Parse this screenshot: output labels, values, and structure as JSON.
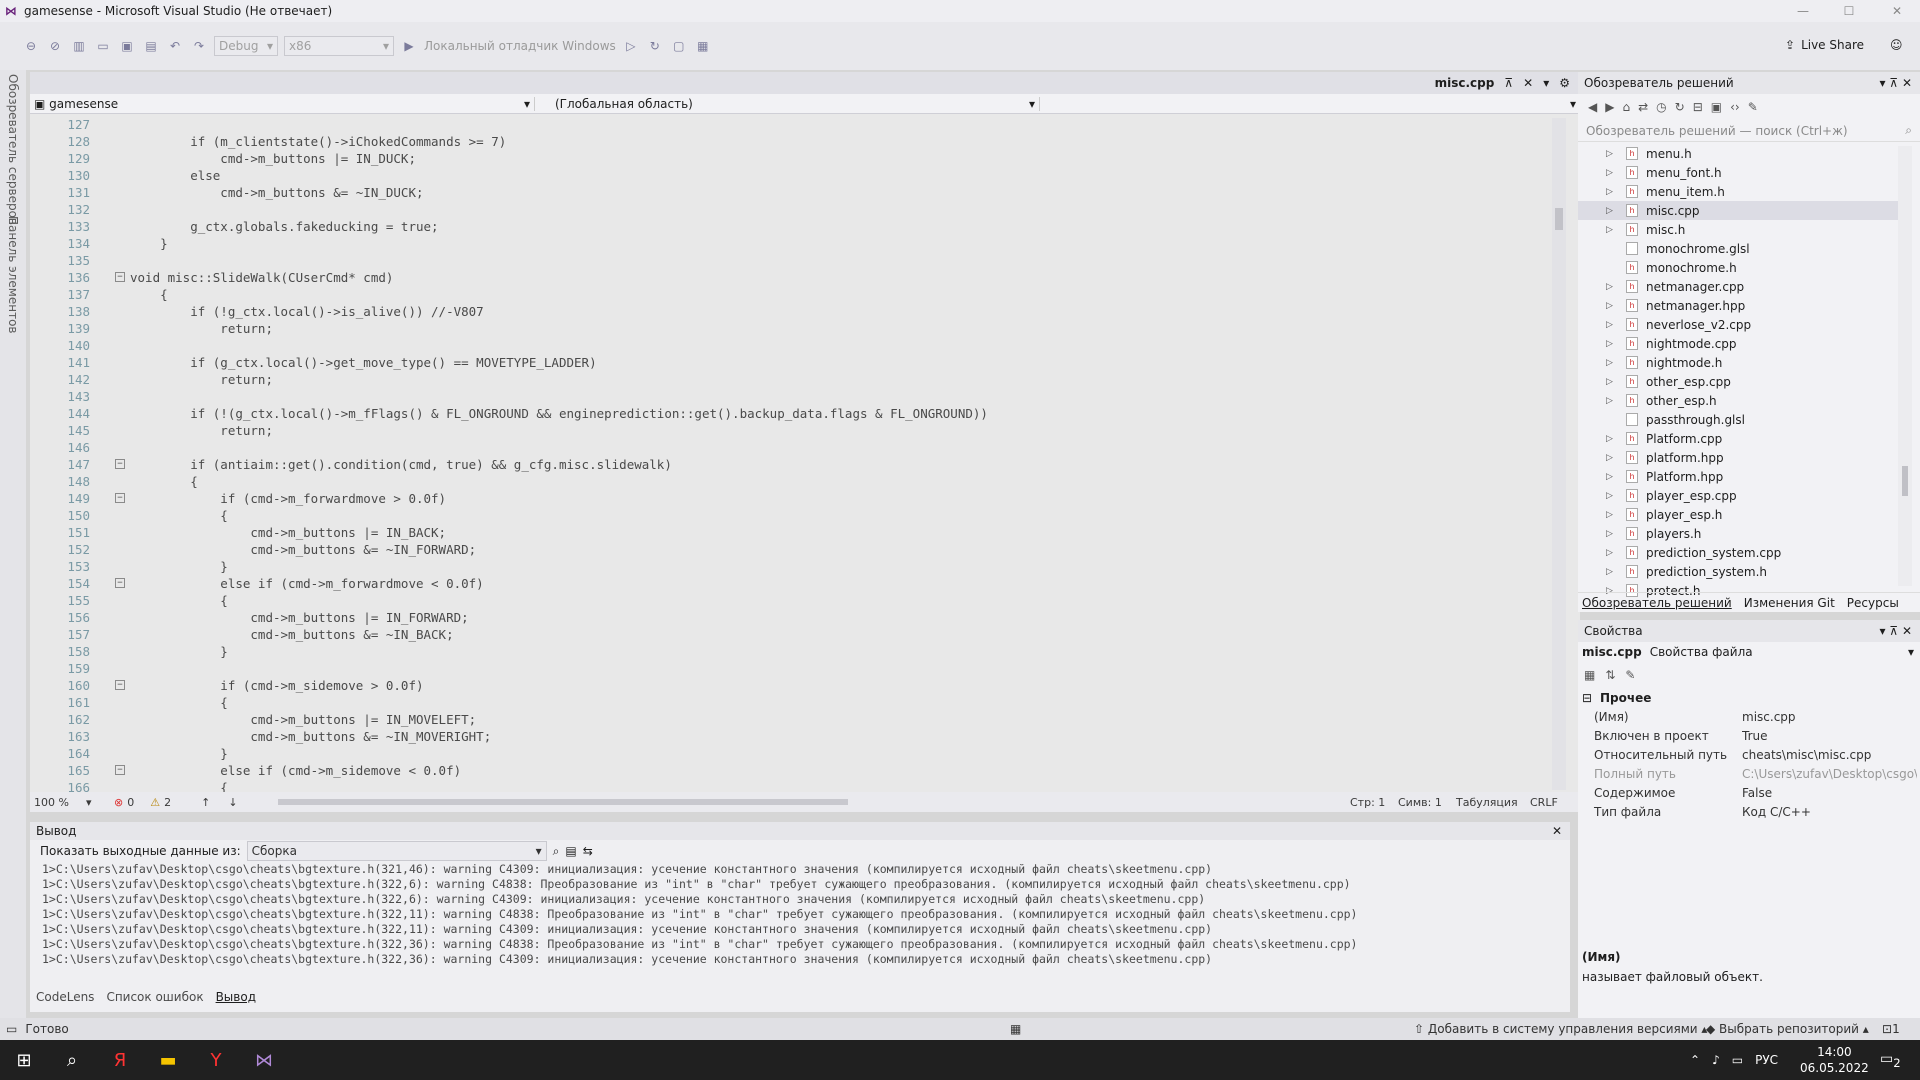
{
  "window": {
    "title": "gamesense - Microsoft Visual Studio (Не отвечает)"
  },
  "toolbar": {
    "config": "Debug",
    "platform": "x86",
    "debugger": "Локальный отладчик Windows",
    "live_share": "Live Share"
  },
  "left_strip": {
    "server_explorer": "Обозреватель серверов",
    "toolbox": "Панель элементов"
  },
  "editor": {
    "tab_name": "misc.cpp",
    "project": "gamesense",
    "scope": "(Глобальная область)",
    "zoom": "100 %",
    "errors": "0",
    "warnings": "2",
    "line": "Стр: 1",
    "char": "Симв: 1",
    "indent": "Табуляция",
    "eol": "CRLF",
    "lines": [
      {
        "n": "127",
        "t": ""
      },
      {
        "n": "128",
        "t": "        if (m_clientstate()->iChokedCommands >= 7)"
      },
      {
        "n": "129",
        "t": "            cmd->m_buttons |= IN_DUCK;"
      },
      {
        "n": "130",
        "t": "        else"
      },
      {
        "n": "131",
        "t": "            cmd->m_buttons &= ~IN_DUCK;"
      },
      {
        "n": "132",
        "t": ""
      },
      {
        "n": "133",
        "t": "        g_ctx.globals.fakeducking = true;"
      },
      {
        "n": "134",
        "t": "    }"
      },
      {
        "n": "135",
        "t": ""
      },
      {
        "n": "136",
        "t": "void misc::SlideWalk(CUserCmd* cmd)"
      },
      {
        "n": "137",
        "t": "    {"
      },
      {
        "n": "138",
        "t": "        if (!g_ctx.local()->is_alive()) //-V807"
      },
      {
        "n": "139",
        "t": "            return;"
      },
      {
        "n": "140",
        "t": ""
      },
      {
        "n": "141",
        "t": "        if (g_ctx.local()->get_move_type() == MOVETYPE_LADDER)"
      },
      {
        "n": "142",
        "t": "            return;"
      },
      {
        "n": "143",
        "t": ""
      },
      {
        "n": "144",
        "t": "        if (!(g_ctx.local()->m_fFlags() & FL_ONGROUND && engineprediction::get().backup_data.flags & FL_ONGROUND))"
      },
      {
        "n": "145",
        "t": "            return;"
      },
      {
        "n": "146",
        "t": ""
      },
      {
        "n": "147",
        "t": "        if (antiaim::get().condition(cmd, true) && g_cfg.misc.slidewalk)"
      },
      {
        "n": "148",
        "t": "        {"
      },
      {
        "n": "149",
        "t": "            if (cmd->m_forwardmove > 0.0f)"
      },
      {
        "n": "150",
        "t": "            {"
      },
      {
        "n": "151",
        "t": "                cmd->m_buttons |= IN_BACK;"
      },
      {
        "n": "152",
        "t": "                cmd->m_buttons &= ~IN_FORWARD;"
      },
      {
        "n": "153",
        "t": "            }"
      },
      {
        "n": "154",
        "t": "            else if (cmd->m_forwardmove < 0.0f)"
      },
      {
        "n": "155",
        "t": "            {"
      },
      {
        "n": "156",
        "t": "                cmd->m_buttons |= IN_FORWARD;"
      },
      {
        "n": "157",
        "t": "                cmd->m_buttons &= ~IN_BACK;"
      },
      {
        "n": "158",
        "t": "            }"
      },
      {
        "n": "159",
        "t": ""
      },
      {
        "n": "160",
        "t": "            if (cmd->m_sidemove > 0.0f)"
      },
      {
        "n": "161",
        "t": "            {"
      },
      {
        "n": "162",
        "t": "                cmd->m_buttons |= IN_MOVELEFT;"
      },
      {
        "n": "163",
        "t": "                cmd->m_buttons &= ~IN_MOVERIGHT;"
      },
      {
        "n": "164",
        "t": "            }"
      },
      {
        "n": "165",
        "t": "            else if (cmd->m_sidemove < 0.0f)"
      },
      {
        "n": "166",
        "t": "            {"
      }
    ]
  },
  "output": {
    "title": "Вывод",
    "show_from_label": "Показать выходные данные из:",
    "source": "Сборка",
    "lines": [
      "1>C:\\Users\\zufav\\Desktop\\csgo\\cheats\\bgtexture.h(321,46): warning C4309: инициализация: усечение константного значения (компилируется исходный файл cheats\\skeetmenu.cpp)",
      "1>C:\\Users\\zufav\\Desktop\\csgo\\cheats\\bgtexture.h(322,6): warning C4838: Преобразование из \"int\" в \"char\" требует сужающего преобразования. (компилируется исходный файл cheats\\skeetmenu.cpp)",
      "1>C:\\Users\\zufav\\Desktop\\csgo\\cheats\\bgtexture.h(322,6): warning C4309: инициализация: усечение константного значения (компилируется исходный файл cheats\\skeetmenu.cpp)",
      "1>C:\\Users\\zufav\\Desktop\\csgo\\cheats\\bgtexture.h(322,11): warning C4838: Преобразование из \"int\" в \"char\" требует сужающего преобразования. (компилируется исходный файл cheats\\skeetmenu.cpp)",
      "1>C:\\Users\\zufav\\Desktop\\csgo\\cheats\\bgtexture.h(322,11): warning C4309: инициализация: усечение константного значения (компилируется исходный файл cheats\\skeetmenu.cpp)",
      "1>C:\\Users\\zufav\\Desktop\\csgo\\cheats\\bgtexture.h(322,36): warning C4838: Преобразование из \"int\" в \"char\" требует сужающего преобразования. (компилируется исходный файл cheats\\skeetmenu.cpp)",
      "1>C:\\Users\\zufav\\Desktop\\csgo\\cheats\\bgtexture.h(322,36): warning C4309: инициализация: усечение константного значения (компилируется исходный файл cheats\\skeetmenu.cpp)"
    ],
    "tabs": [
      "CodeLens",
      "Список ошибок",
      "Вывод"
    ]
  },
  "solution_explorer": {
    "title": "Обозреватель решений",
    "search_placeholder": "Обозреватель решений — поиск (Ctrl+ж)",
    "files": [
      {
        "name": "menu.h",
        "exp": true
      },
      {
        "name": "menu_font.h",
        "exp": true
      },
      {
        "name": "menu_item.h",
        "exp": true
      },
      {
        "name": "misc.cpp",
        "exp": true,
        "sel": true
      },
      {
        "name": "misc.h",
        "exp": true
      },
      {
        "name": "monochrome.glsl",
        "exp": false
      },
      {
        "name": "monochrome.h",
        "exp": false
      },
      {
        "name": "netmanager.cpp",
        "exp": true
      },
      {
        "name": "netmanager.hpp",
        "exp": true
      },
      {
        "name": "neverlose_v2.cpp",
        "exp": true
      },
      {
        "name": "nightmode.cpp",
        "exp": true
      },
      {
        "name": "nightmode.h",
        "exp": true
      },
      {
        "name": "other_esp.cpp",
        "exp": true
      },
      {
        "name": "other_esp.h",
        "exp": true
      },
      {
        "name": "passthrough.glsl",
        "exp": false
      },
      {
        "name": "Platform.cpp",
        "exp": true
      },
      {
        "name": "platform.hpp",
        "exp": true
      },
      {
        "name": "Platform.hpp",
        "exp": true
      },
      {
        "name": "player_esp.cpp",
        "exp": true
      },
      {
        "name": "player_esp.h",
        "exp": true
      },
      {
        "name": "players.h",
        "exp": true
      },
      {
        "name": "prediction_system.cpp",
        "exp": true
      },
      {
        "name": "prediction_system.h",
        "exp": true
      },
      {
        "name": "protect.h",
        "exp": true
      }
    ],
    "tabs": [
      "Обозреватель решений",
      "Изменения Git",
      "Ресурсы"
    ]
  },
  "properties": {
    "title": "Свойства",
    "object": "misc.cpp",
    "object_type": "Свойства файла",
    "category": "Прочее",
    "rows": [
      {
        "k": "(Имя)",
        "v": "misc.cpp"
      },
      {
        "k": "Включен в проект",
        "v": "True"
      },
      {
        "k": "Относительный путь",
        "v": "cheats\\misc\\misc.cpp"
      },
      {
        "k": "Полный путь",
        "v": "C:\\Users\\zufav\\Desktop\\csgo\\cl"
      },
      {
        "k": "Содержимое",
        "v": "False"
      },
      {
        "k": "Тип файла",
        "v": "Код C/C++"
      }
    ],
    "desc_title": "(Имя)",
    "desc_text": "называет файловый объект."
  },
  "status": {
    "ready": "Готово",
    "add_vcs": "Добавить в систему управления версиями",
    "select_repo": "Выбрать репозиторий",
    "notif": "1"
  },
  "taskbar": {
    "lang": "РУС",
    "time": "14:00",
    "date": "06.05.2022",
    "notif_count": "2"
  }
}
